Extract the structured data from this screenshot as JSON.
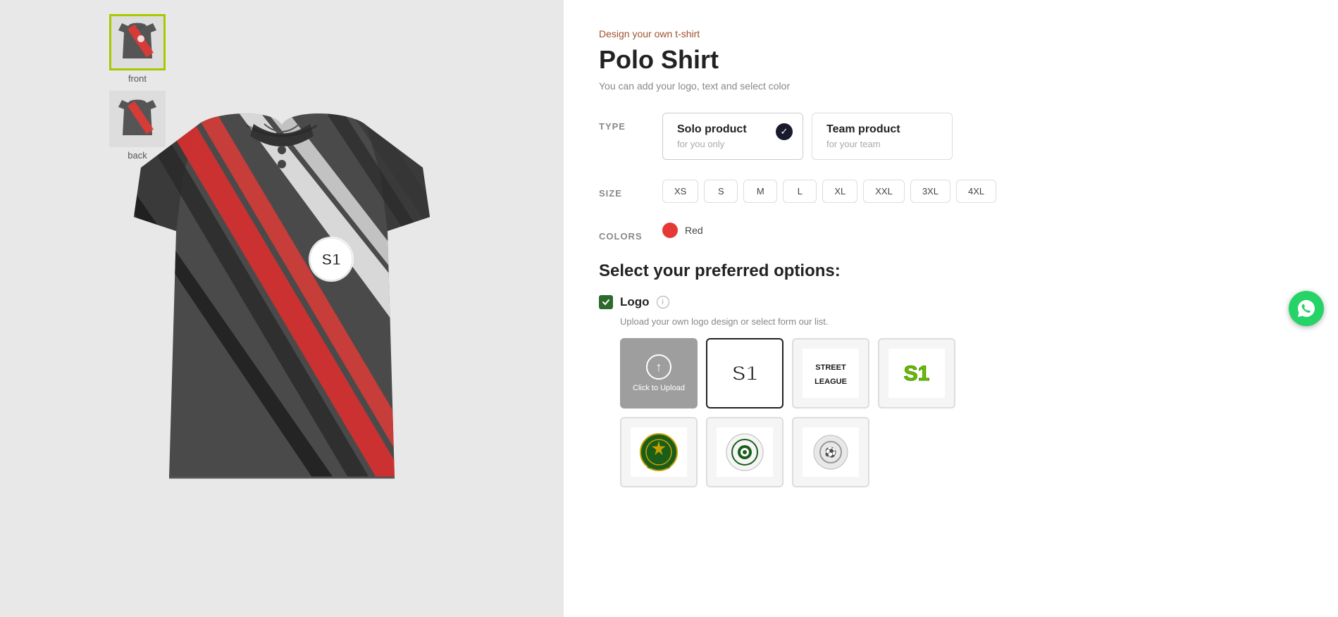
{
  "page": {
    "subtitle": "Design your own t-shirt",
    "title": "Polo Shirt",
    "description": "You can add your logo, text and select color"
  },
  "thumbnails": [
    {
      "label": "front",
      "active": true
    },
    {
      "label": "back",
      "active": false
    }
  ],
  "type_section": {
    "label": "TYPE",
    "options": [
      {
        "title": "Solo product",
        "subtitle": "for you only",
        "selected": true
      },
      {
        "title": "Team product",
        "subtitle": "for your team",
        "selected": false
      }
    ]
  },
  "size_section": {
    "label": "SIZE",
    "options": [
      "XS",
      "S",
      "M",
      "L",
      "XL",
      "XXL",
      "3XL",
      "4XL"
    ]
  },
  "colors_section": {
    "label": "COLORS",
    "selected": "Red",
    "color": "#e53935"
  },
  "preferred_section": {
    "title": "Select your preferred options:",
    "logo_option": {
      "label": "Logo",
      "checked": true,
      "hint": "Upload your own logo design or select form our list.",
      "upload_label": "Click to Upload"
    }
  }
}
